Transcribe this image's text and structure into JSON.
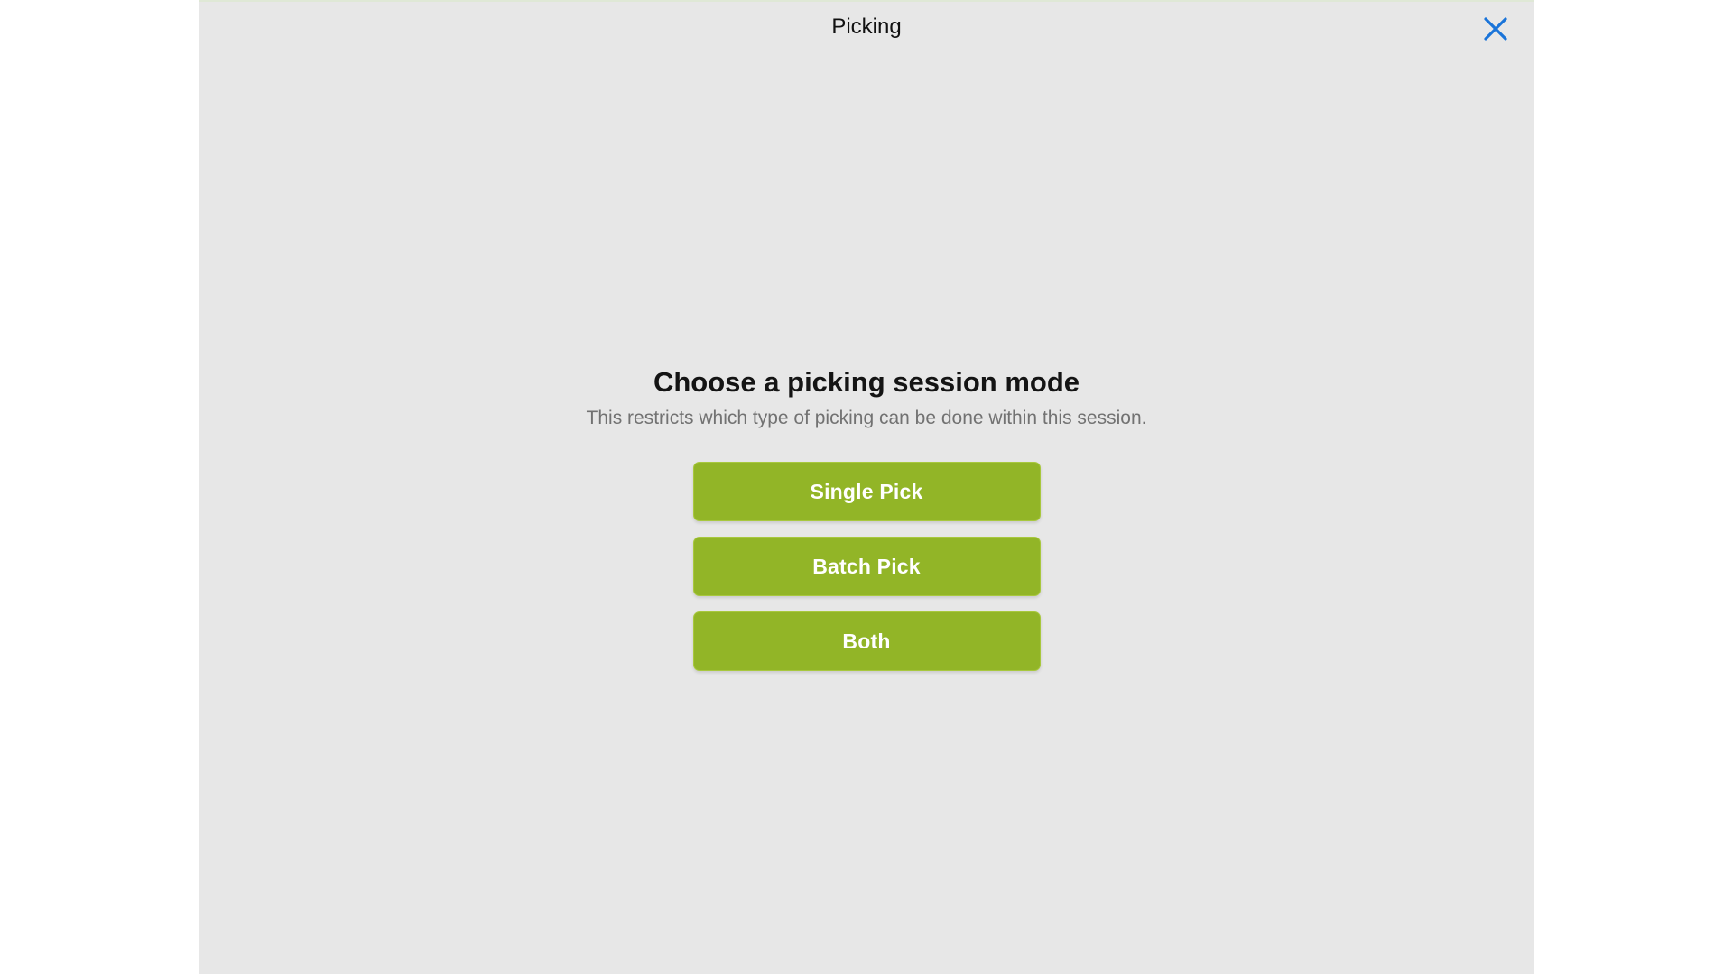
{
  "header": {
    "title": "Picking",
    "close_icon": "close-icon"
  },
  "main": {
    "heading": "Choose a picking session mode",
    "description": "This restricts which type of picking can be done within this session.",
    "options": [
      {
        "label": "Single Pick"
      },
      {
        "label": "Batch Pick"
      },
      {
        "label": "Both"
      }
    ]
  },
  "colors": {
    "accent_button": "#92b527",
    "close_icon": "#1a74d9",
    "background": "#e7e7e7"
  }
}
